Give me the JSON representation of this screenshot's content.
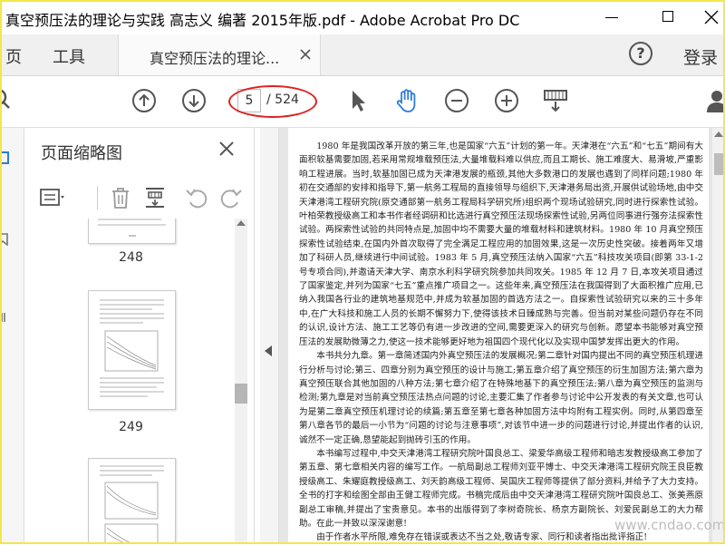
{
  "window": {
    "title": "真空预压法的理论与实践 高志义 编著 2015年版.pdf - Adobe Acrobat Pro DC"
  },
  "tabs": {
    "menu_page": "页",
    "menu_tools": "工具",
    "doc_tab_label": "真空预压法的理论...",
    "help": "?",
    "login": "登录"
  },
  "toolbar": {
    "current_page": "5",
    "total_pages": "/ 524"
  },
  "thumbnails": {
    "title": "页面缩略图",
    "pages": [
      "248",
      "249"
    ]
  },
  "document": {
    "paragraphs": [
      "1980 年是我国改革开放的第三年,也是国家“六五”计划的第一年。天津港在“六五”和“七五”期间有大面积软基需要加固,若采用常规堆载预压法,大量堆载料难以供应,而且工期长、施工难度大、易滑坡,严重影响工程进展。当时,软基加固已成为天津港发展的瓶颈,其他大多数港口的发展也遇到了同样问题;1980 年初在交通部的安排和指导下,第一航务工程局的直接领导与组织下,天津港务局出资,开展供试验场地,由中交天津港湾工程研究院(原交通部第一航务工程局科学研究所)组织两个现场试验研究,同时进行探索性试验。叶柏荣教授级高工和本书作者经调研和比选进行真空预压法现场探索性试验,另两位同事进行强夯法探索性试验。两探索性试验的共同特点是,加固中均不需要大量的堆载材料和建筑材料。1980 年 10 月真空预压探索性试验结束,在国内外首次取得了完全满足工程应用的加固效果,这是一次历史性突破。接着两年又增加了科研人员,继续进行中间试验。1983 年 5 月,真空预压法纳入国家“六五”科技攻关项目(即第 33-1-2 号专项合同),并邀请天津大学、南京水利科学研究院参加共同攻关。1985 年 12 月 7 日,本攻关项目通过了国家鉴定,并列为国家“七五”重点推广项目之一。这些年来,真空预压法在我国得到了大面积推广应用,已纳入我国各行业的建筑地基规范中,并成为软基加固的首选方法之一。自探索性试验研究以来的三十多年中,在广大科技和施工人员的长期不懈努力下,使得该技术日臻成熟与完善。但当前对某些问题仍存在不同的认识,设计方法、施工工艺等仍有进一步改进的空间,需要更深入的研究与创新。愿望本书能够对真空预压法的发展助微薄之力,使这一技术能够更好地为祖国四个现代化以及实现中国梦发挥出更大的作用。",
      "本书共分九章。第一章简述国内外真空预压法的发展概况;第二章针对国内提出不同的真空预压机理进行分析与讨论;第三、四章分别为真空预压的设计与施工;第五章介绍了真空预压的衍生加固方法;第六章为真空预压联合其他加固的八种方法;第七章介绍了在特殊地基下的真空预压法;第八章为真空预压的监测与检测;第九章是对当前真空预压法热点问题的讨论,主要汇集了作者参与讨论中公开发表的有关文章,也可认为是第二章真空预压机理讨论的续篇;第五章至第七章各种加固方法中均附有工程实例。同时,从第四章至第八章各节的最后一小节为“问题的讨论与注意事项”,对该节中进一步的问题进行讨论,并提出作者的认识,诚然不一定正确,恳望能起到抛砖引玉的作用。",
      "本书编写过程中,中交天津港湾工程研究院叶国良总工、梁爱华高级工程师和暗志发教授级高工参加了第五章、第七章相关内容的编写工作。一航局副总工程师刘亚平博士、中交天津港湾工程研究院王良臣教授级高工、朱耀庭教授级高工、刘天韵高级工程师、吴国庆工程师等提供了部分资料,并给予了大力支持。全书的打字和绘图全部由王健工程师完成。书稿完成后由中交天津港湾工程研究院叶国良总工、张美燕原副总工审稿,并提出了宝贵意见。本书的出版得到了李树奇院长、杨京方副院长、刘爱民副总工的大力帮助。在此一并致以深深谢意!",
      "由于作者水平所限,难免存在错误或表达不当之处,敬请专家、同行和读者指出批评指正!"
    ]
  },
  "watermark": "www.cndao.com",
  "colors": {
    "accent_blue": "#2f7bd6",
    "highlight_red": "#e02020",
    "frame_yellow": "#f3e64a"
  }
}
